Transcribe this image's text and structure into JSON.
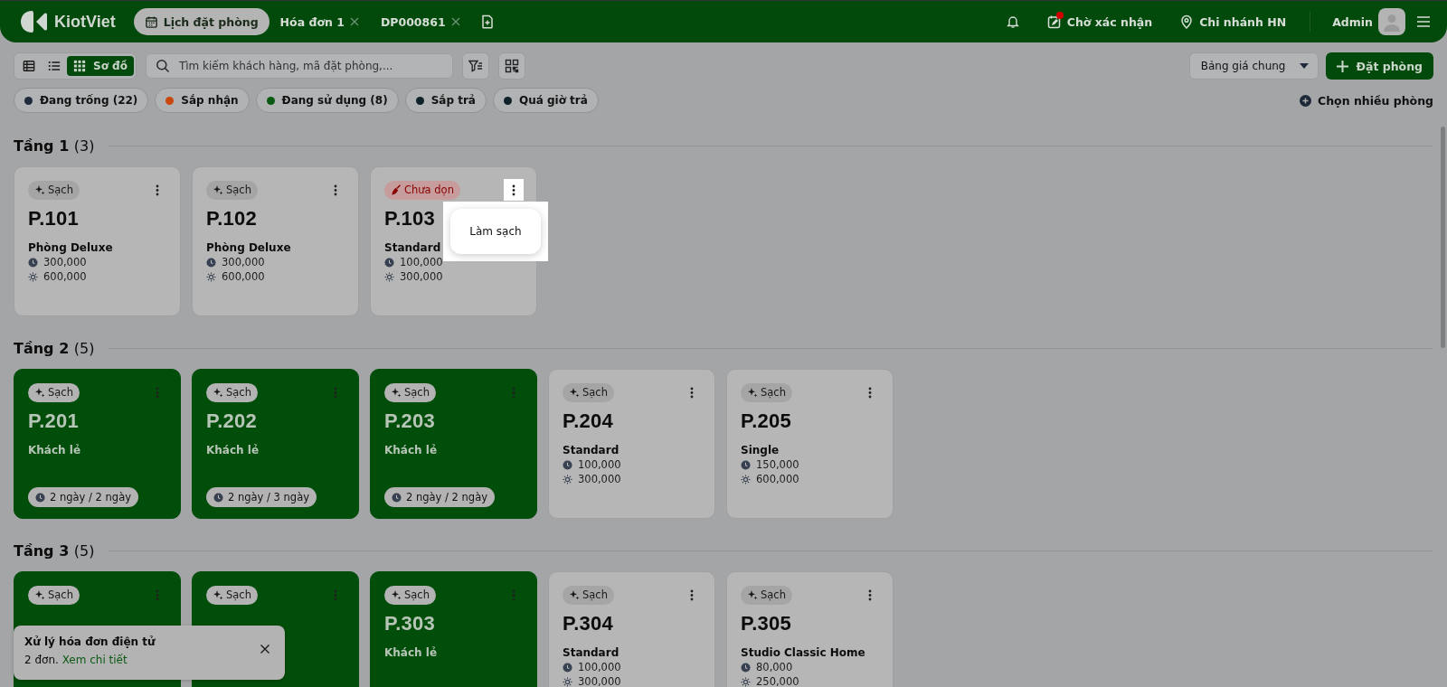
{
  "header": {
    "logo": "KiotViet",
    "tabs": [
      {
        "label": "Lịch đặt phòng",
        "selected": true,
        "kind": "calendar"
      },
      {
        "label": "Hóa đơn 1",
        "selected": false,
        "kind": "closable"
      },
      {
        "label": "DP000861",
        "selected": false,
        "kind": "closable"
      }
    ],
    "pending": {
      "label": "Chờ xác nhận",
      "alert": true
    },
    "branch": "Chi nhánh HN",
    "user": "Admin"
  },
  "toolbar": {
    "view_modes": [
      {
        "kind": "table",
        "selected": false
      },
      {
        "kind": "list",
        "selected": false
      },
      {
        "kind": "grid",
        "label": "Sơ đồ",
        "selected": true
      }
    ],
    "search": {
      "placeholder": "Tìm kiếm khách hàng, mã đặt phòng,..."
    },
    "price_list": "Bảng giá chung",
    "add_button": "Đặt phòng"
  },
  "filters": [
    {
      "label": "Đang trống (22)",
      "color": "#1e2b3c"
    },
    {
      "label": "Sắp nhận",
      "color": "#c8480f"
    },
    {
      "label": "Đang sử dụng (8)",
      "color": "#0b5a14"
    },
    {
      "label": "Sắp trả",
      "color": "#0f2229"
    },
    {
      "label": "Quá giờ trả",
      "color": "#0f2229"
    }
  ],
  "select_multiple": "Chọn nhiều phòng",
  "floors": [
    {
      "name": "Tầng 1",
      "count": "(3)",
      "rooms": [
        {
          "name": "P.101",
          "status": {
            "label": "Sạch",
            "kind": "clean"
          },
          "occupied": false,
          "type": "Phòng Deluxe",
          "hourly": "300,000",
          "daily": "600,000"
        },
        {
          "name": "P.102",
          "status": {
            "label": "Sạch",
            "kind": "clean"
          },
          "occupied": false,
          "type": "Phòng Deluxe",
          "hourly": "300,000",
          "daily": "600,000"
        },
        {
          "name": "P.103",
          "status": {
            "label": "Chưa dọn",
            "kind": "dirty"
          },
          "occupied": false,
          "type": "Standard",
          "hourly": "100,000",
          "daily": "300,000",
          "menu_open": true,
          "menu_items": [
            "Làm sạch"
          ]
        }
      ]
    },
    {
      "name": "Tầng 2",
      "count": "(5)",
      "rooms": [
        {
          "name": "P.201",
          "status": {
            "label": "Sạch",
            "kind": "clean"
          },
          "occupied": true,
          "guest": "Khách lẻ",
          "stay": "2 ngày / 2 ngày"
        },
        {
          "name": "P.202",
          "status": {
            "label": "Sạch",
            "kind": "clean"
          },
          "occupied": true,
          "guest": "Khách lẻ",
          "stay": "2 ngày / 3 ngày"
        },
        {
          "name": "P.203",
          "status": {
            "label": "Sạch",
            "kind": "clean"
          },
          "occupied": true,
          "guest": "Khách lẻ",
          "stay": "2 ngày / 2 ngày"
        },
        {
          "name": "P.204",
          "status": {
            "label": "Sạch",
            "kind": "clean"
          },
          "occupied": false,
          "type": "Standard",
          "hourly": "100,000",
          "daily": "300,000"
        },
        {
          "name": "P.205",
          "status": {
            "label": "Sạch",
            "kind": "clean"
          },
          "occupied": false,
          "type": "Single",
          "hourly": "150,000",
          "daily": "600,000"
        }
      ]
    },
    {
      "name": "Tầng 3",
      "count": "(5)",
      "rooms": [
        {
          "status": {
            "label": "Sạch",
            "kind": "clean"
          },
          "occupied": true
        },
        {
          "status": {
            "label": "Sạch",
            "kind": "clean"
          },
          "occupied": true
        },
        {
          "name": "P.303",
          "status": {
            "label": "Sạch",
            "kind": "clean"
          },
          "occupied": true,
          "guest": "Khách lẻ"
        },
        {
          "name": "P.304",
          "status": {
            "label": "Sạch",
            "kind": "clean"
          },
          "occupied": false,
          "type": "Standard",
          "hourly": "100,000",
          "daily": "300,000"
        },
        {
          "name": "P.305",
          "status": {
            "label": "Sạch",
            "kind": "clean"
          },
          "occupied": false,
          "type": "Studio Classic Home",
          "hourly": "80,000",
          "daily": "250,000"
        }
      ]
    }
  ],
  "toast": {
    "title": "Xử lý hóa đơn điện tử",
    "text": "2 đơn.",
    "link": "Xem chi tiết"
  }
}
